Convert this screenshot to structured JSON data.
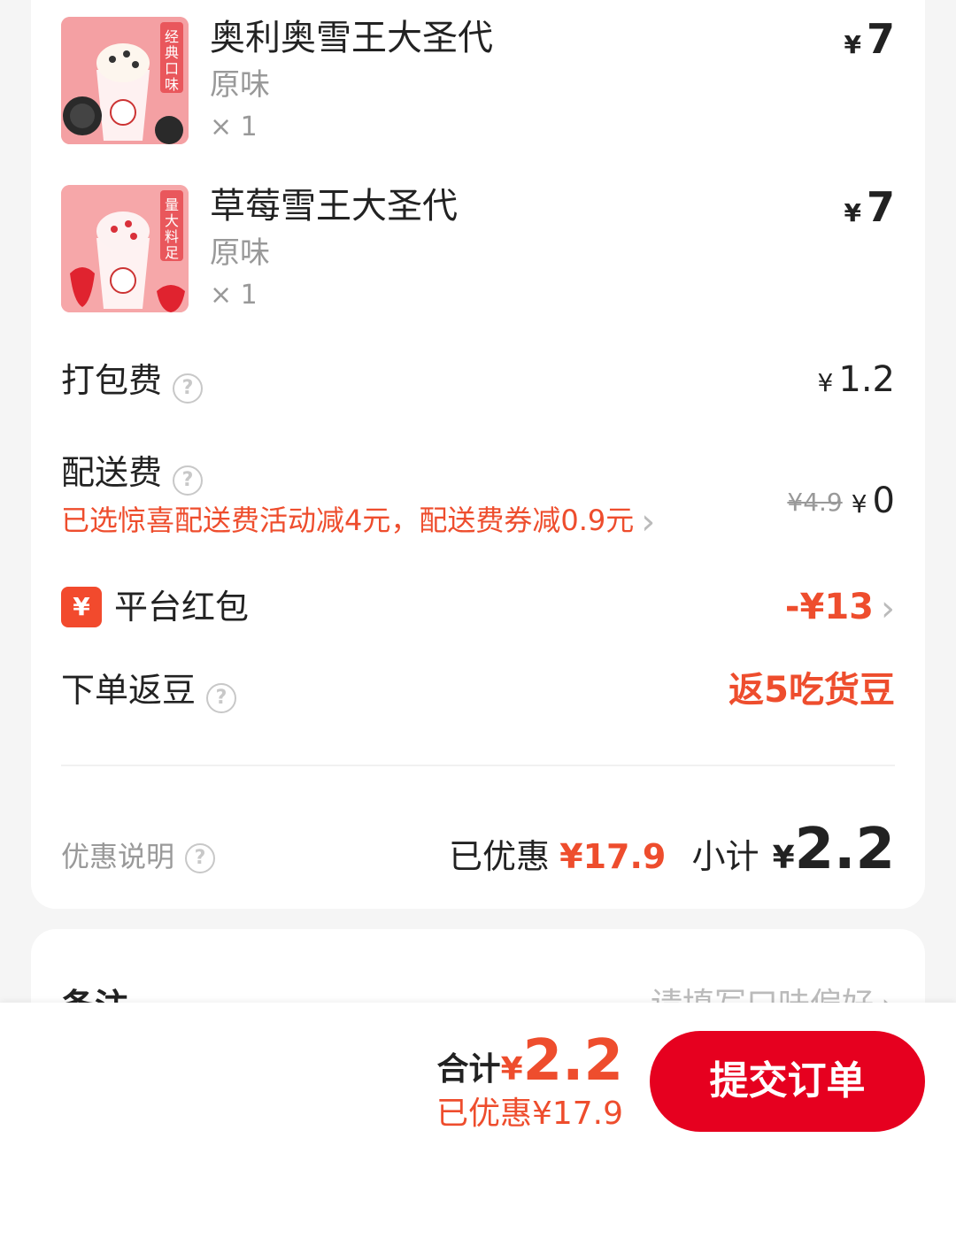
{
  "items": [
    {
      "name": "奥利奥雪王大圣代",
      "spec": "原味",
      "qty": "× 1",
      "currency": "¥",
      "price": "7",
      "badge": "经典口味"
    },
    {
      "name": "草莓雪王大圣代",
      "spec": "原味",
      "qty": "× 1",
      "currency": "¥",
      "price": "7",
      "badge": "量大料足"
    }
  ],
  "packing": {
    "label": "打包费",
    "currency": "¥",
    "value": "1.2"
  },
  "delivery": {
    "label": "配送费",
    "note": "已选惊喜配送费活动减4元，配送费券减0.9元",
    "original": "¥4.9",
    "currency": "¥",
    "value": "0"
  },
  "redpacket": {
    "icon_char": "¥",
    "label": "平台红包",
    "value": "-¥13"
  },
  "beans": {
    "label": "下单返豆",
    "value": "返5吃货豆"
  },
  "summary": {
    "discount_info_label": "优惠说明",
    "discounted_label": "已优惠",
    "discounted_value": "¥17.9",
    "subtotal_label": "小计",
    "subtotal_currency": "¥",
    "subtotal_value": "2.2"
  },
  "remark": {
    "label": "备注",
    "placeholder": "请填写口味偏好"
  },
  "footer": {
    "total_label": "合计",
    "total_currency": "¥",
    "total_value": "2.2",
    "discount_text": "已优惠¥17.9",
    "submit_label": "提交订单"
  },
  "colors": {
    "accent": "#ee4d2d",
    "submit": "#e6001f"
  }
}
